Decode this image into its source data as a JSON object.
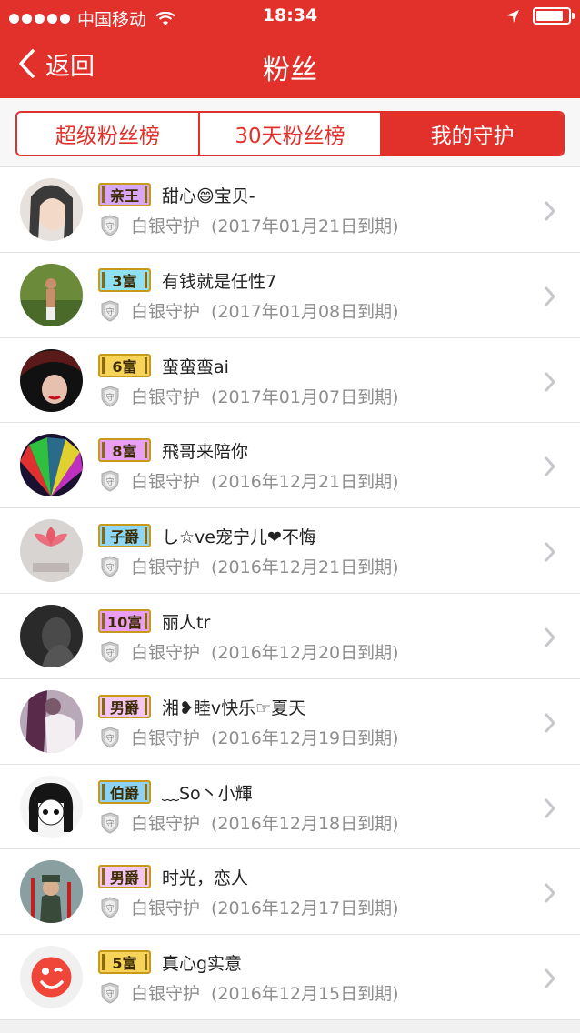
{
  "status_bar": {
    "carrier": "中国移动",
    "time": "18:34",
    "battery_level": 0.85
  },
  "nav": {
    "back_label": "返回",
    "title": "粉丝"
  },
  "tabs": [
    {
      "label": "超级粉丝榜",
      "active": false
    },
    {
      "label": "30天粉丝榜",
      "active": false
    },
    {
      "label": "我的守护",
      "active": true
    }
  ],
  "fans": [
    {
      "badge": "亲王",
      "badge_color": "#d7a6f5",
      "name": "甜心😄宝贝-",
      "guard": "白银守护",
      "expire": "(2017年01月21日到期)"
    },
    {
      "badge": "3富",
      "badge_color": "#8fe0f0",
      "name": "有钱就是任性7",
      "guard": "白银守护",
      "expire": "(2017年01月08日到期)"
    },
    {
      "badge": "6富",
      "badge_color": "#f7d35a",
      "name": "蛮蛮蛮ai",
      "guard": "白银守护",
      "expire": "(2017年01月07日到期)"
    },
    {
      "badge": "8富",
      "badge_color": "#e9a0f2",
      "name": "飛哥来陪你",
      "guard": "白银守护",
      "expire": "(2016年12月21日到期)"
    },
    {
      "badge": "子爵",
      "badge_color": "#8fd6f5",
      "name": "し☆ve宠宁儿❤不悔",
      "guard": "白银守护",
      "expire": "(2016年12月21日到期)"
    },
    {
      "badge": "10富",
      "badge_color": "#ea9ef1",
      "name": "丽人tr",
      "guard": "白银守护",
      "expire": "(2016年12月20日到期)"
    },
    {
      "badge": "男爵",
      "badge_color": "#f3c7f2",
      "name": "湘❥睦v快乐☞夏天",
      "guard": "白银守护",
      "expire": "(2016年12月19日到期)"
    },
    {
      "badge": "伯爵",
      "badge_color": "#8cd3f3",
      "name": "﹏So丶小輝",
      "guard": "白银守护",
      "expire": "(2016年12月18日到期)"
    },
    {
      "badge": "男爵",
      "badge_color": "#f3c7f2",
      "name": "时光，恋人",
      "guard": "白银守护",
      "expire": "(2016年12月17日到期)"
    },
    {
      "badge": "5富",
      "badge_color": "#f7d35a",
      "name": "真心g实意",
      "guard": "白银守护",
      "expire": "(2016年12月15日到期)"
    }
  ],
  "avatar_colors": [
    "#3a3a3a",
    "#6b8a3a",
    "#5a1a1a",
    "#2a6a8a",
    "#d8d4d2",
    "#4a4a4a",
    "#7a5a6a",
    "#f5f5f5",
    "#3a4a3a",
    "#f0f0f0"
  ],
  "theme": {
    "accent": "#e2312b"
  }
}
